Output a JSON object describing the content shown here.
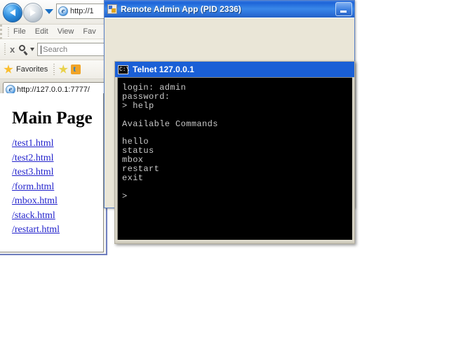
{
  "browser": {
    "nav": {
      "back_icon": "back-arrow-icon",
      "forward_icon": "forward-arrow-icon",
      "recent_pages_icon": "chevron-down-icon",
      "address_value": "http://1",
      "address_placeholder": "http://"
    },
    "menu": [
      "File",
      "Edit",
      "View",
      "Fav"
    ],
    "search": {
      "stop_label": "x",
      "search_icon": "magnifier-icon",
      "provider_caret": "chevron-down-icon",
      "placeholder": "Search",
      "value": ""
    },
    "favorites": {
      "label": "Favorites",
      "star_icon": "star-icon",
      "add_favorite_icon": "add-to-favorites-icon",
      "feed_icon": "suggested-sites-icon"
    },
    "tab": {
      "favicon": "ie-logo-icon",
      "label": "http://127.0.0.1:7777/"
    },
    "page": {
      "heading": "Main Page",
      "links": [
        "/test1.html",
        "/test2.html",
        "/test3.html",
        "/form.html",
        "/mbox.html",
        "/stack.html",
        "/restart.html"
      ]
    }
  },
  "admin_window": {
    "icon": "app-window-icon",
    "title": "Remote Admin App (PID 2336)",
    "minimize_icon": "minimize-icon",
    "client_text": ""
  },
  "telnet_window": {
    "icon": "console-icon",
    "title": "Telnet 127.0.0.1",
    "terminal_text": "login: admin\npassword:\n> help\n\nAvailable Commands\n\nhello\nstatus\nmbox\nrestart\nexit\n\n>",
    "prompt_lines": {
      "login": "login: admin",
      "password": "password:",
      "command": "> help",
      "section": "Available Commands",
      "commands": [
        "hello",
        "status",
        "mbox",
        "restart",
        "exit"
      ],
      "prompt": ">"
    }
  },
  "colors": {
    "titlebar_blue": "#1d64d8",
    "telnet_title_blue": "#1a5fd6",
    "admin_client_beige": "#eae6d7",
    "terminal_bg": "#000000",
    "terminal_fg": "#c8c8c8",
    "link_blue": "#2222cc"
  }
}
